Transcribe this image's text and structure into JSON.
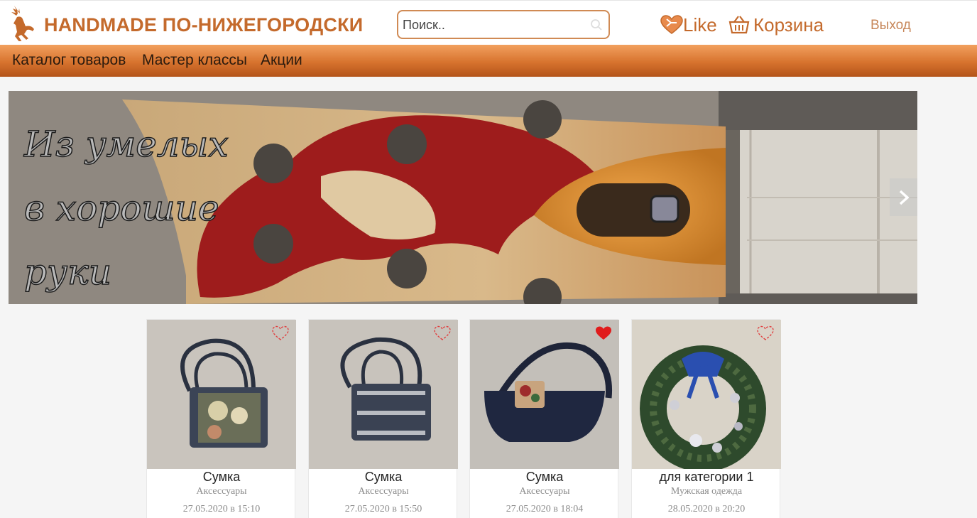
{
  "header": {
    "brand": "HANDMADE ПО-НИЖЕГОРОДСКИ",
    "search_placeholder": "Поиск..",
    "like_label": "Like",
    "cart_label": "Корзина",
    "logout_label": "Выход",
    "accent_color": "#c46a2c"
  },
  "nav": {
    "items": [
      {
        "label": "Каталог товаров"
      },
      {
        "label": "Мастер классы"
      },
      {
        "label": "Акции"
      }
    ]
  },
  "banner": {
    "lines": [
      "Из умелых",
      "в хорошие",
      "руки"
    ]
  },
  "products": [
    {
      "title": "Сумка",
      "category": "Аксессуары",
      "date": "27.05.2020 в 15:10",
      "liked": false
    },
    {
      "title": "Сумка",
      "category": "Аксессуары",
      "date": "27.05.2020 в 15:50",
      "liked": false
    },
    {
      "title": "Сумка",
      "category": "Аксессуары",
      "date": "27.05.2020 в 18:04",
      "liked": true
    },
    {
      "title": "для категории 1",
      "category": "Мужская одежда",
      "date": "28.05.2020 в 20:20",
      "liked": false
    }
  ]
}
